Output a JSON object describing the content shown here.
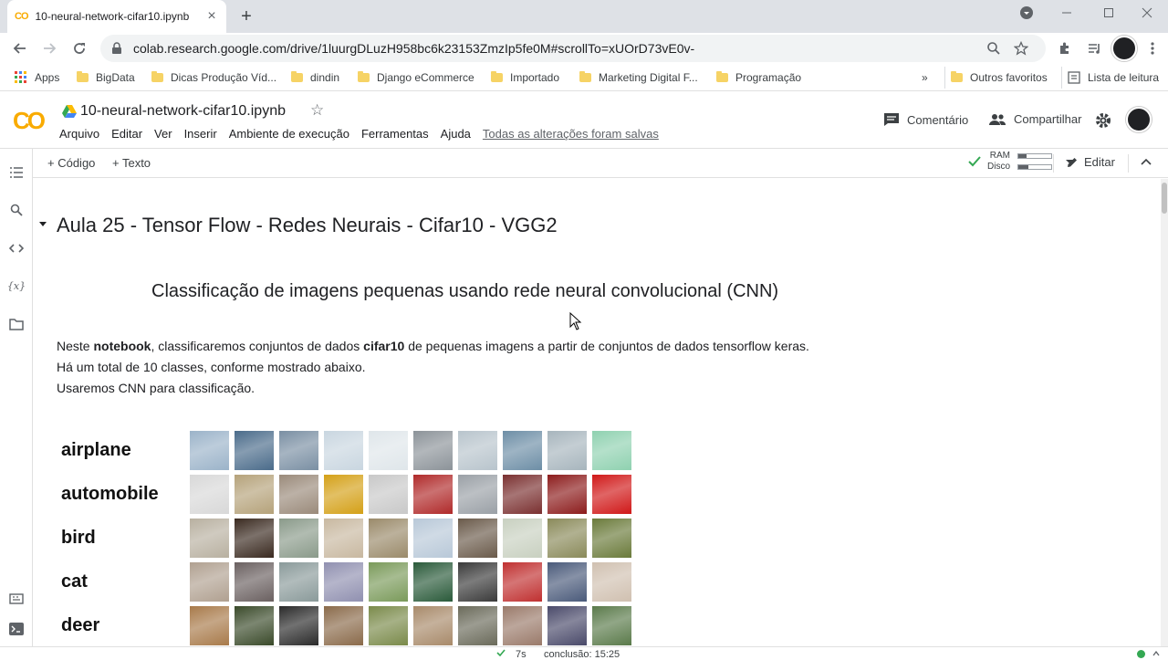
{
  "browser": {
    "tab_title": "10-neural-network-cifar10.ipynb",
    "tab_logo": "CO",
    "url": "colab.research.google.com/drive/1luurgDLuzH958bc6k23153ZmzIp5fe0M#scrollTo=xUOrD73vE0v-",
    "bookmarks": [
      "Apps",
      "BigData",
      "Dicas Produção Víd...",
      "dindin",
      "Django eCommerce",
      "Importado",
      "Marketing Digital F...",
      "Programação"
    ],
    "bookmarks_overflow": "»",
    "other_bookmarks": "Outros favoritos",
    "reading_list": "Lista de leitura"
  },
  "colab": {
    "logo": "CO",
    "notebook_title": "10-neural-network-cifar10.ipynb",
    "menu": [
      "Arquivo",
      "Editar",
      "Ver",
      "Inserir",
      "Ambiente de execução",
      "Ferramentas",
      "Ajuda"
    ],
    "saved_status": "Todas as alterações foram salvas",
    "comment_label": "Comentário",
    "share_label": "Compartilhar",
    "add_code": "+ Código",
    "add_text": "+ Texto",
    "ram_label": "RAM",
    "disk_label": "Disco",
    "ram_usage": 0.25,
    "disk_usage": 0.3,
    "edit_label": "Editar"
  },
  "notebook": {
    "section_title": "Aula 25 - Tensor Flow - Redes Neurais - Cifar10 - VGG2",
    "subtitle": "Classificação de imagens pequenas usando rede neural convolucional (CNN)",
    "para1_a": "Neste ",
    "para1_b": "notebook",
    "para1_c": ", classificaremos conjuntos de dados ",
    "para1_d": "cifar10",
    "para1_e": " de pequenas imagens a partir de conjuntos de dados tensorflow keras.",
    "para2": "Há um total de 10 classes, conforme mostrado abaixo.",
    "para3": "Usaremos CNN para classificação.",
    "classes": [
      "airplane",
      "automobile",
      "bird",
      "cat",
      "deer"
    ]
  },
  "status": {
    "exec_time": "7s",
    "completion": "conclusão: 15:25"
  },
  "colors": {
    "colab_orange": "#f9ab00",
    "ok_green": "#34a853"
  }
}
